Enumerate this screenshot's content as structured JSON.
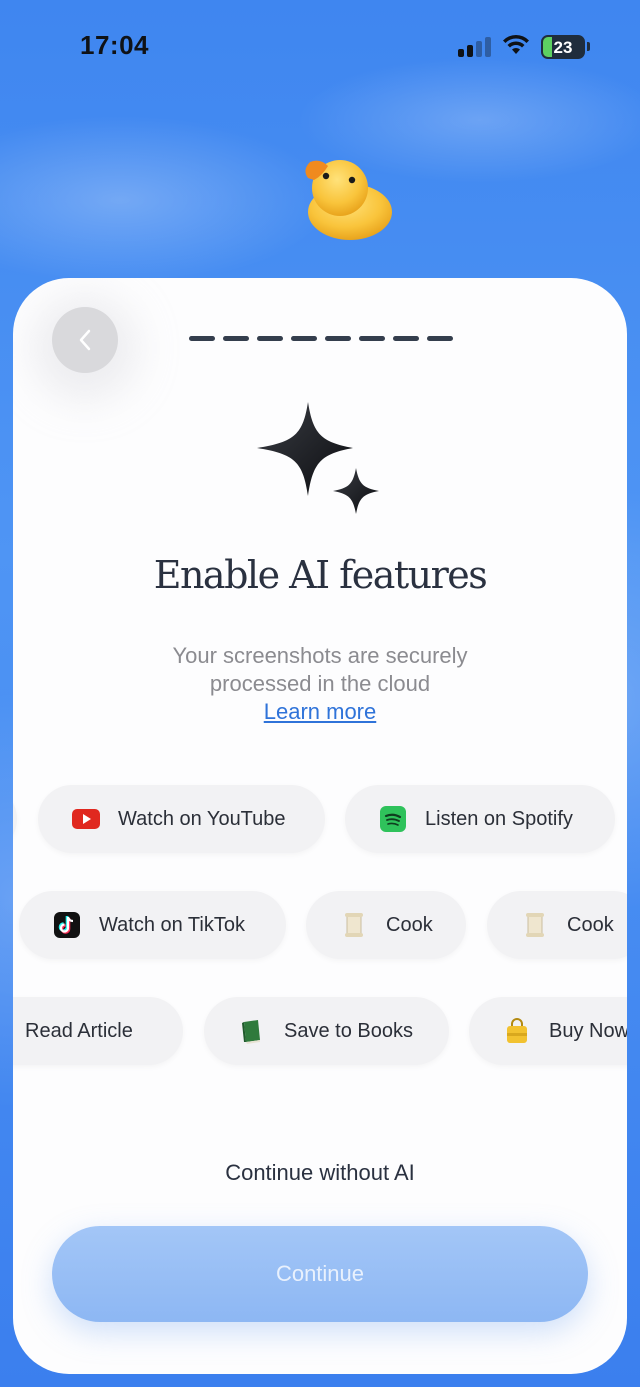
{
  "status_bar": {
    "time": "17:04",
    "battery": "23"
  },
  "onboarding": {
    "progress_steps": 8,
    "title": "Enable AI features",
    "subtitle_line1": "Your screenshots are securely",
    "subtitle_line2": "processed in the cloud",
    "learn_more": "Learn more"
  },
  "chips": {
    "row1": [
      {
        "label": "Watch on YouTube",
        "icon": "youtube-icon"
      },
      {
        "label": "Listen on Spotify",
        "icon": "spotify-icon"
      }
    ],
    "row2": [
      {
        "label": "Watch on TikTok",
        "icon": "tiktok-icon"
      },
      {
        "label": "Cook",
        "icon": "scroll-icon"
      },
      {
        "label": "Cook",
        "icon": "scroll-icon"
      }
    ],
    "row3": [
      {
        "label": "Read Article",
        "icon": "article-icon"
      },
      {
        "label": "Save to Books",
        "icon": "book-icon"
      },
      {
        "label": "Buy Now",
        "icon": "shopping-bag-icon"
      }
    ]
  },
  "actions": {
    "continue_without_ai": "Continue without AI",
    "continue": "Continue"
  },
  "colors": {
    "background": "#4a8ff3",
    "title": "#2a3140",
    "link": "#2f73d9",
    "continue_button": "#97bdf5"
  }
}
